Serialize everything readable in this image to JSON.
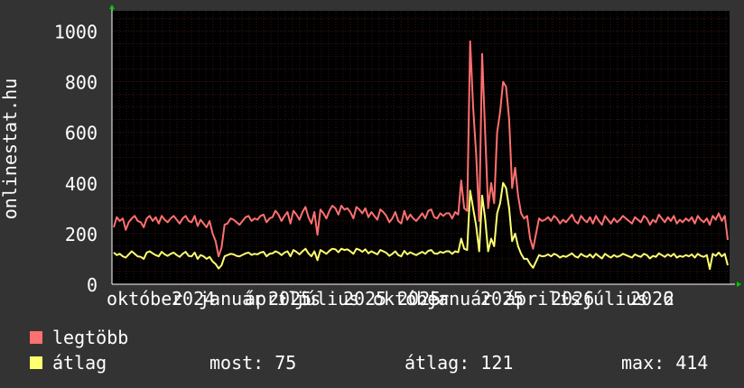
{
  "chart_data": {
    "type": "line",
    "ylabel": "onlinestat.hu",
    "ylim": [
      0,
      1080
    ],
    "yticks": [
      0,
      200,
      400,
      600,
      800,
      1000
    ],
    "xticks": [
      "október",
      "2024",
      "január",
      "április",
      "2025",
      "július",
      "2025",
      "október",
      "2025",
      "január",
      "2025",
      "április",
      "2026",
      "július",
      "2026",
      "2"
    ],
    "grid": true,
    "legend_placement": "bottom-left",
    "series": [
      {
        "name": "legtöbb",
        "color": "#ff7070",
        "values": [
          225,
          265,
          250,
          260,
          215,
          245,
          260,
          270,
          250,
          245,
          225,
          260,
          270,
          250,
          265,
          240,
          270,
          255,
          245,
          260,
          270,
          255,
          240,
          260,
          270,
          250,
          245,
          270,
          230,
          255,
          240,
          225,
          250,
          200,
          170,
          110,
          145,
          235,
          240,
          260,
          255,
          245,
          235,
          250,
          265,
          270,
          250,
          260,
          255,
          270,
          275,
          245,
          260,
          265,
          290,
          275,
          250,
          270,
          285,
          240,
          290,
          275,
          255,
          285,
          305,
          265,
          240,
          285,
          195,
          295,
          280,
          260,
          290,
          310,
          300,
          275,
          310,
          295,
          300,
          285,
          260,
          305,
          295,
          280,
          300,
          265,
          285,
          270,
          255,
          295,
          285,
          270,
          245,
          260,
          285,
          250,
          240,
          290,
          255,
          275,
          260,
          250,
          265,
          280,
          260,
          290,
          295,
          265,
          260,
          280,
          270,
          280,
          280,
          260,
          285,
          275,
          410,
          300,
          290,
          960,
          700,
          510,
          250,
          910,
          600,
          300,
          400,
          320,
          600,
          680,
          800,
          780,
          650,
          380,
          460,
          350,
          280,
          260,
          270,
          180,
          140,
          200,
          260,
          250,
          255,
          265,
          250,
          270,
          260,
          240,
          255,
          245,
          260,
          275,
          250,
          240,
          270,
          255,
          245,
          265,
          240,
          270,
          250,
          235,
          270,
          255,
          240,
          260,
          245,
          255,
          270,
          260,
          250,
          240,
          265,
          255,
          245,
          270,
          260,
          235,
          255,
          245,
          275,
          260,
          245,
          265,
          250,
          270,
          240,
          255,
          245,
          260,
          250,
          265,
          240,
          270,
          255,
          245,
          260,
          235,
          270,
          255,
          280,
          250,
          270,
          175
        ]
      },
      {
        "name": "átlag",
        "color": "#ffff70",
        "values": [
          125,
          115,
          120,
          110,
          105,
          118,
          130,
          120,
          110,
          108,
          100,
          125,
          130,
          122,
          115,
          110,
          128,
          118,
          112,
          120,
          125,
          115,
          108,
          120,
          128,
          112,
          110,
          125,
          100,
          115,
          110,
          100,
          108,
          90,
          80,
          62,
          75,
          110,
          115,
          120,
          118,
          112,
          110,
          116,
          122,
          125,
          116,
          120,
          118,
          125,
          128,
          110,
          120,
          122,
          130,
          125,
          115,
          125,
          130,
          110,
          135,
          128,
          118,
          130,
          140,
          122,
          110,
          130,
          95,
          135,
          128,
          120,
          132,
          140,
          138,
          126,
          140,
          135,
          138,
          130,
          120,
          140,
          136,
          128,
          138,
          122,
          130,
          124,
          118,
          135,
          130,
          124,
          112,
          120,
          130,
          115,
          110,
          132,
          118,
          126,
          120,
          115,
          122,
          128,
          120,
          132,
          135,
          122,
          120,
          128,
          124,
          130,
          130,
          120,
          130,
          126,
          180,
          140,
          135,
          370,
          300,
          230,
          130,
          350,
          260,
          130,
          180,
          150,
          280,
          320,
          400,
          380,
          300,
          170,
          200,
          150,
          120,
          100,
          100,
          80,
          65,
          90,
          115,
          110,
          112,
          118,
          110,
          120,
          115,
          105,
          112,
          108,
          115,
          122,
          110,
          105,
          120,
          112,
          108,
          118,
          105,
          120,
          110,
          102,
          120,
          112,
          105,
          115,
          108,
          112,
          120,
          115,
          110,
          105,
          118,
          112,
          108,
          120,
          115,
          102,
          112,
          108,
          122,
          115,
          108,
          118,
          110,
          120,
          105,
          112,
          108,
          115,
          110,
          118,
          105,
          120,
          112,
          108,
          115,
          60,
          120,
          112,
          125,
          110,
          120,
          75
        ]
      }
    ]
  },
  "legend": [
    {
      "label": "legtöbb",
      "color": "#ff7070"
    },
    {
      "label": "átlag",
      "color": "#ffff70"
    }
  ],
  "stats": {
    "most": "most: 75",
    "avg": "átlag: 121",
    "max": "max: 414"
  }
}
